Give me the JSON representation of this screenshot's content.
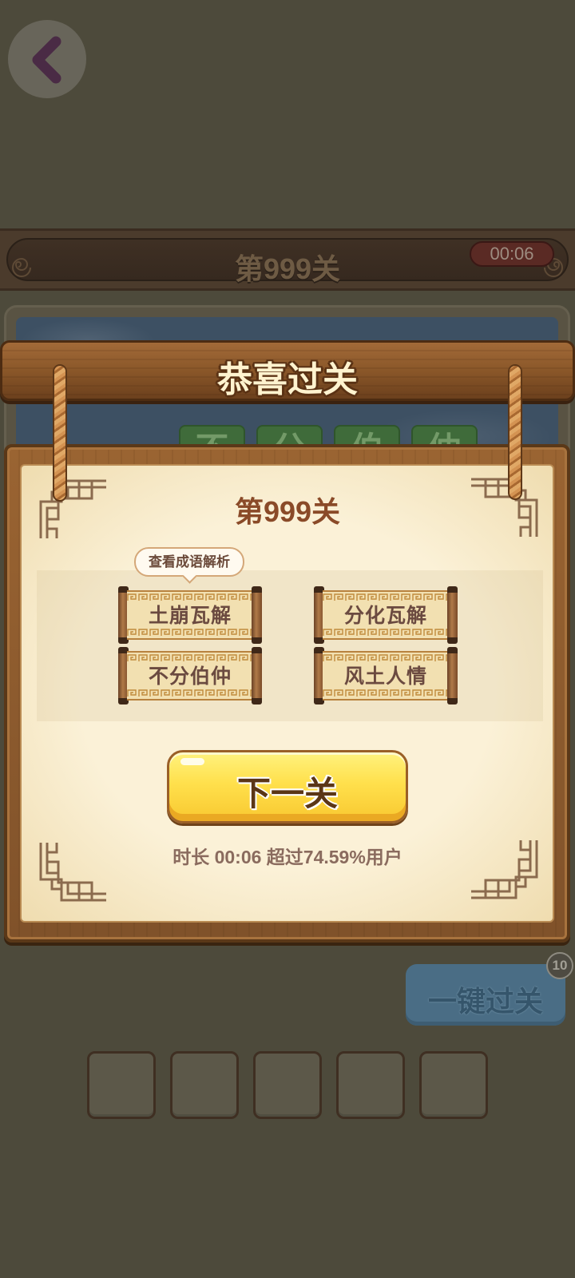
{
  "nav": {
    "back_icon": "chevron-left-icon"
  },
  "header": {
    "level_title": "第999关",
    "timer": "00:06"
  },
  "puzzle": {
    "tiles": [
      "不",
      "分",
      "伯",
      "仲"
    ]
  },
  "modal": {
    "banner_title": "恭喜过关",
    "level_title": "第999关",
    "tooltip": "查看成语解析",
    "idioms": [
      "土崩瓦解",
      "分化瓦解",
      "不分伯仲",
      "风土人情"
    ],
    "next_button": "下一关",
    "stats": "时长 00:06 超过74.59%用户"
  },
  "bottom": {
    "skip_button": "一键过关",
    "skip_badge": "10",
    "answer_slots": [
      "",
      "",
      "",
      "",
      ""
    ]
  },
  "colors": {
    "page_overlay": "#4d4a3b",
    "parchment": "#f8eed3",
    "title_brown": "#8a4a28",
    "next_button_yellow": "#f9d83e",
    "skip_button_blue": "#4a6d85",
    "timer_red": "#5a2a24"
  },
  "icons": {
    "back": "chevron-left-icon",
    "corner_ornament": "lattice-corner-icon",
    "header_ornament": "swirl-icon"
  }
}
